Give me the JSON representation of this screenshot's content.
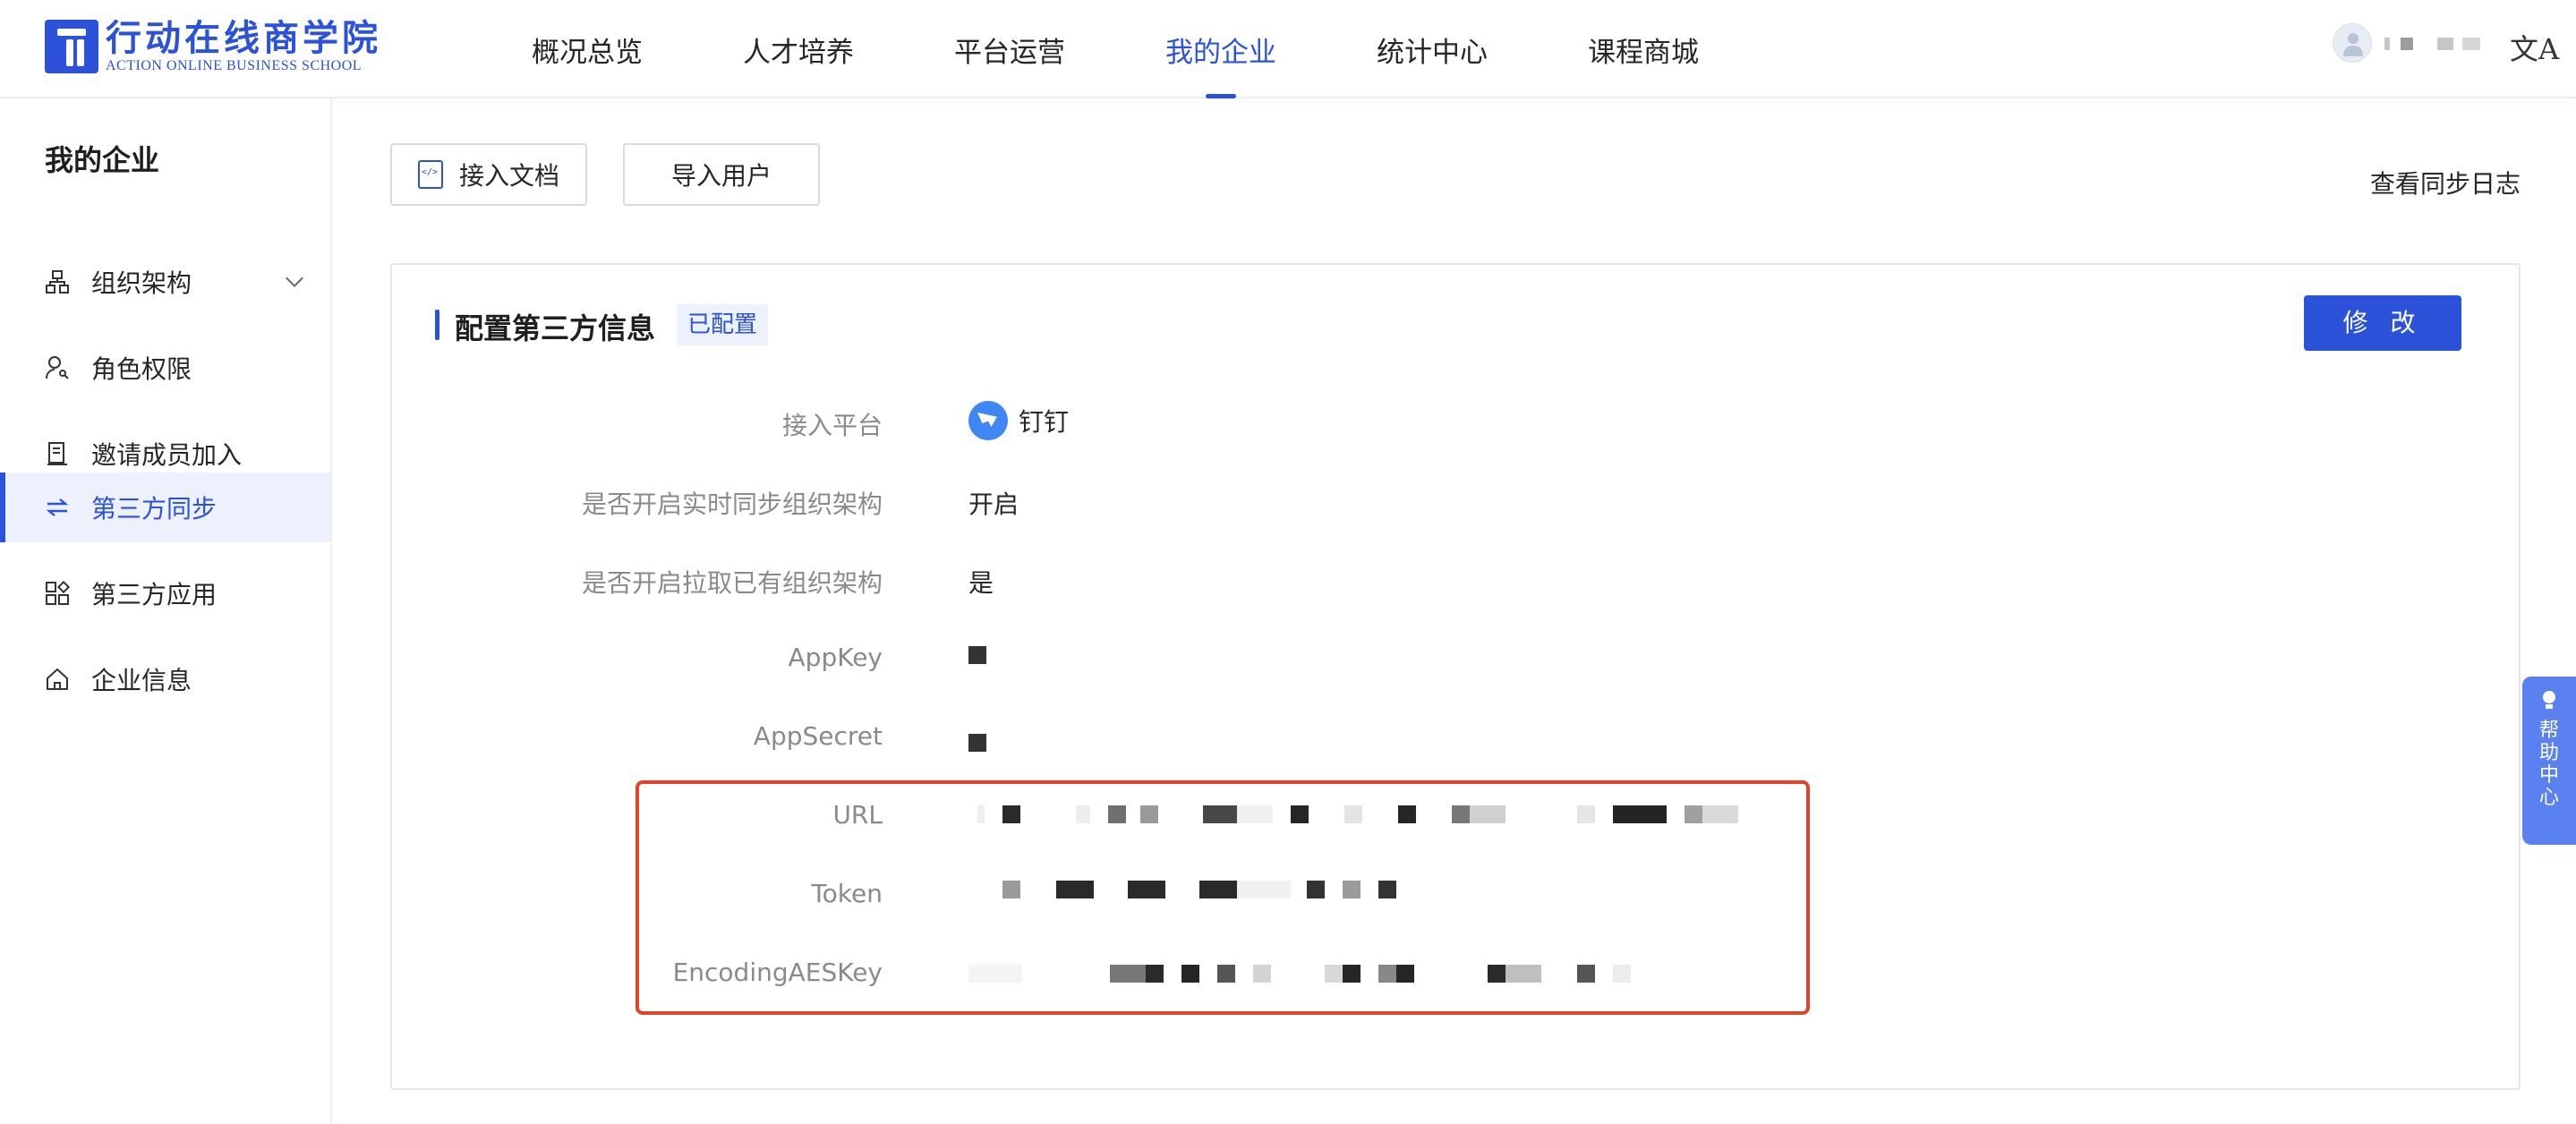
{
  "app": {
    "logo_cn": "行动在线商学院",
    "logo_en": "ACTION ONLINE BUSINESS SCHOOL"
  },
  "nav": {
    "items": [
      {
        "label": "概况总览",
        "active": false
      },
      {
        "label": "人才培养",
        "active": false
      },
      {
        "label": "平台运营",
        "active": false
      },
      {
        "label": "我的企业",
        "active": true
      },
      {
        "label": "统计中心",
        "active": false
      },
      {
        "label": "课程商城",
        "active": false
      }
    ],
    "lang_icon": "文A"
  },
  "sidebar": {
    "title": "我的企业",
    "items": [
      {
        "label": "组织架构",
        "icon": "org-chart-icon",
        "active": false,
        "expandable": true
      },
      {
        "label": "角色权限",
        "icon": "user-key-icon",
        "active": false
      },
      {
        "label": "邀请成员加入",
        "icon": "invite-doc-icon",
        "active": false
      },
      {
        "label": "第三方同步",
        "icon": "sync-arrows-icon",
        "active": true
      },
      {
        "label": "第三方应用",
        "icon": "apps-grid-icon",
        "active": false
      },
      {
        "label": "企业信息",
        "icon": "home-icon",
        "active": false
      }
    ]
  },
  "toolbar": {
    "docs_label": "接入文档",
    "import_label": "导入用户",
    "sync_log_label": "查看同步日志"
  },
  "panel": {
    "title": "配置第三方信息",
    "status_badge": "已配置",
    "edit_label": "修 改",
    "rows": [
      {
        "label": "接入平台",
        "value": "钉钉"
      },
      {
        "label": "是否开启实时同步组织架构",
        "value": "开启"
      },
      {
        "label": "是否开启拉取已有组织架构",
        "value": "是"
      },
      {
        "label": "AppKey",
        "value": ""
      },
      {
        "label": "AppSecret",
        "value": ""
      },
      {
        "label": "URL",
        "value": ""
      },
      {
        "label": "Token",
        "value": ""
      },
      {
        "label": "EncodingAESKey",
        "value": ""
      }
    ]
  },
  "help": {
    "label": "帮助中心"
  },
  "colors": {
    "primary": "#2b52d9",
    "active_bg": "#edf0fd",
    "highlight_border": "#e0432e",
    "help_bg": "#5b80f0"
  }
}
